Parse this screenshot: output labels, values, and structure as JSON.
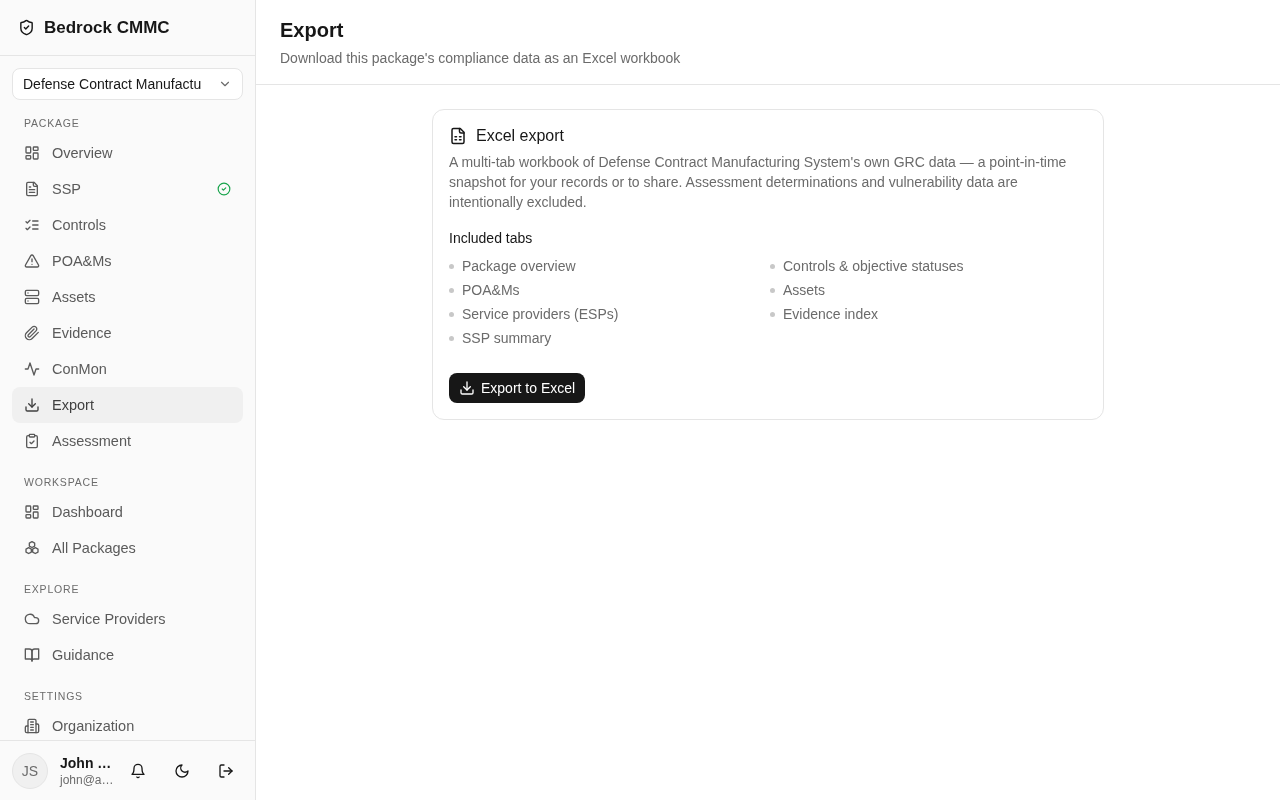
{
  "app": {
    "name": "Bedrock CMMC"
  },
  "package_select": {
    "value": "Defense Contract Manufactu"
  },
  "sidebar": {
    "sections": [
      {
        "label": "PACKAGE",
        "items": [
          {
            "label": "Overview",
            "selected": false,
            "complete": false
          },
          {
            "label": "SSP",
            "selected": false,
            "complete": true
          },
          {
            "label": "Controls",
            "selected": false,
            "complete": false
          },
          {
            "label": "POA&Ms",
            "selected": false,
            "complete": false
          },
          {
            "label": "Assets",
            "selected": false,
            "complete": false
          },
          {
            "label": "Evidence",
            "selected": false,
            "complete": false
          },
          {
            "label": "ConMon",
            "selected": false,
            "complete": false
          },
          {
            "label": "Export",
            "selected": true,
            "complete": false
          },
          {
            "label": "Assessment",
            "selected": false,
            "complete": false
          }
        ]
      },
      {
        "label": "WORKSPACE",
        "items": [
          {
            "label": "Dashboard",
            "selected": false,
            "complete": false
          },
          {
            "label": "All Packages",
            "selected": false,
            "complete": false
          }
        ]
      },
      {
        "label": "EXPLORE",
        "items": [
          {
            "label": "Service Providers",
            "selected": false,
            "complete": false
          },
          {
            "label": "Guidance",
            "selected": false,
            "complete": false
          }
        ]
      },
      {
        "label": "SETTINGS",
        "items": [
          {
            "label": "Organization",
            "selected": false,
            "complete": false
          }
        ]
      }
    ]
  },
  "user": {
    "initials": "JS",
    "name": "John …",
    "email": "john@a…"
  },
  "page": {
    "title": "Export",
    "subtitle": "Download this package's compliance data as an Excel workbook"
  },
  "card": {
    "title": "Excel export",
    "description": "A multi-tab workbook of Defense Contract Manufacturing System's own GRC data — a point-in-time snapshot for your records or to share. Assessment determinations and vulnerability data are intentionally excluded.",
    "included_label": "Included tabs",
    "included_tabs": [
      "Package overview",
      "Controls & objective statuses",
      "POA&Ms",
      "Assets",
      "Service providers (ESPs)",
      "Evidence index",
      "SSP summary"
    ],
    "button": "Export to Excel"
  }
}
